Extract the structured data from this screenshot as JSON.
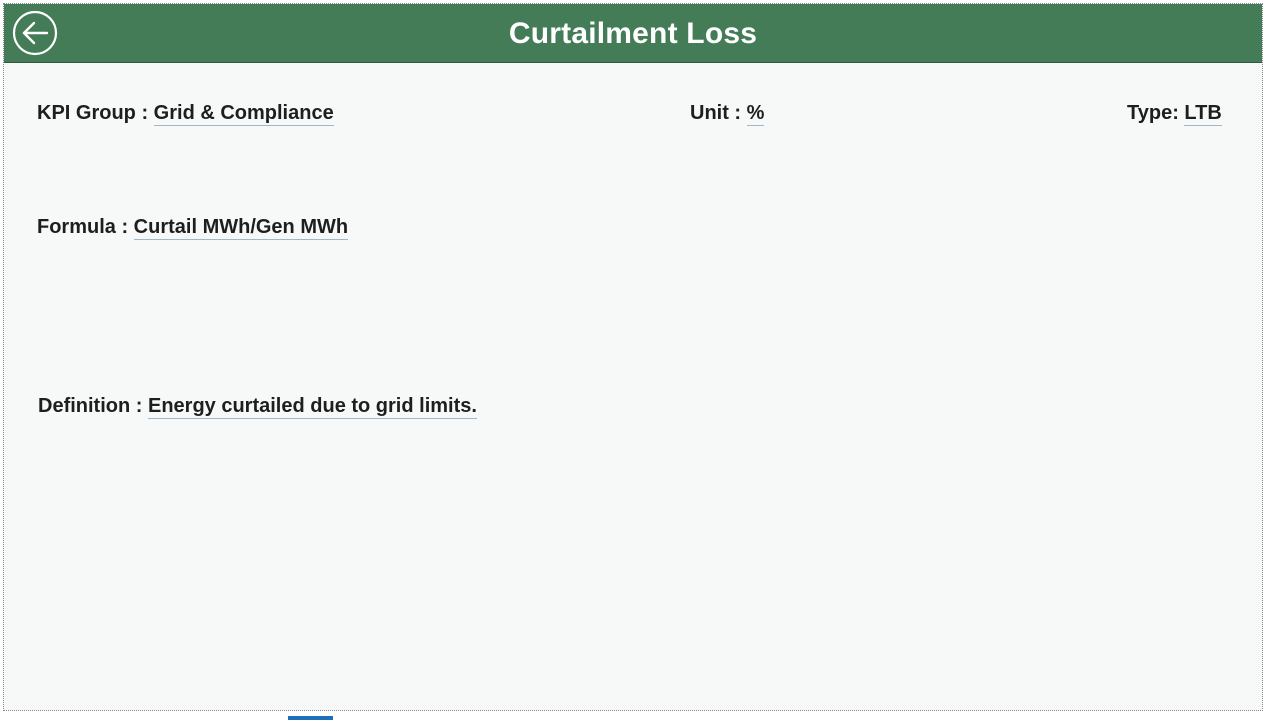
{
  "header": {
    "title": "Curtailment Loss",
    "back_icon": "arrow-left-circle-icon",
    "color": "#437c56"
  },
  "fields": {
    "kpi_group": {
      "label": "KPI Group : ",
      "value": "Grid & Compliance"
    },
    "unit": {
      "label": "Unit : ",
      "value": "%"
    },
    "type": {
      "label": "Type: ",
      "value": "LTB"
    },
    "formula": {
      "label": "Formula : ",
      "value": "Curtail MWh/Gen MWh"
    },
    "definition": {
      "label": "Definition : ",
      "value": "Energy curtailed due to grid limits."
    }
  }
}
